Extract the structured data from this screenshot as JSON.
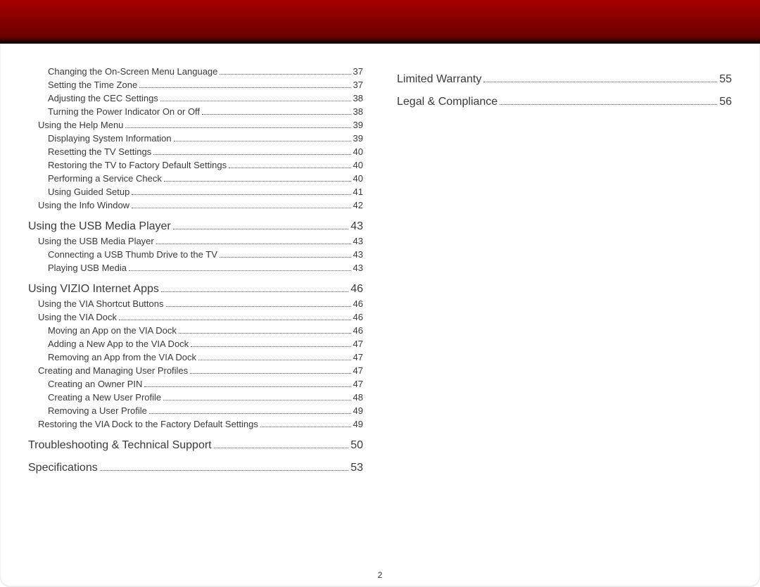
{
  "page_number": "2",
  "columns": [
    [
      {
        "level": 2,
        "label": "Changing the On-Screen Menu Language",
        "page": "37"
      },
      {
        "level": 2,
        "label": "Setting the Time Zone",
        "page": "37"
      },
      {
        "level": 2,
        "label": "Adjusting the CEC Settings",
        "page": "38"
      },
      {
        "level": 2,
        "label": "Turning the Power Indicator On or Off",
        "page": "38"
      },
      {
        "level": 1,
        "label": "Using the Help Menu",
        "page": "39"
      },
      {
        "level": 2,
        "label": "Displaying System Information",
        "page": "39"
      },
      {
        "level": 2,
        "label": "Resetting the TV Settings",
        "page": "40"
      },
      {
        "level": 2,
        "label": "Restoring the TV to Factory Default Settings",
        "page": "40"
      },
      {
        "level": 2,
        "label": "Performing a Service Check",
        "page": "40"
      },
      {
        "level": 2,
        "label": "Using Guided Setup",
        "page": "41"
      },
      {
        "level": 1,
        "label": "Using the Info Window",
        "page": "42"
      },
      {
        "level": 0,
        "label": "Using the USB Media Player",
        "page": "43"
      },
      {
        "level": 1,
        "label": "Using the USB Media Player",
        "page": "43"
      },
      {
        "level": 2,
        "label": "Connecting a USB Thumb Drive to the TV",
        "page": "43"
      },
      {
        "level": 2,
        "label": "Playing USB Media",
        "page": "43"
      },
      {
        "level": 0,
        "label": "Using VIZIO Internet Apps",
        "page": "46"
      },
      {
        "level": 1,
        "label": "Using the VIA Shortcut Buttons",
        "page": "46"
      },
      {
        "level": 1,
        "label": "Using the VIA Dock",
        "page": "46"
      },
      {
        "level": 2,
        "label": "Moving an App on the VIA Dock",
        "page": "46"
      },
      {
        "level": 2,
        "label": "Adding a New App to the VIA Dock",
        "page": "47"
      },
      {
        "level": 2,
        "label": "Removing an App from the VIA Dock",
        "page": "47"
      },
      {
        "level": 1,
        "label": "Creating and Managing User Profiles",
        "page": "47"
      },
      {
        "level": 2,
        "label": "Creating an Owner PIN",
        "page": "47"
      },
      {
        "level": 2,
        "label": "Creating a New User Profile",
        "page": "48"
      },
      {
        "level": 2,
        "label": "Removing a User Profile",
        "page": "49"
      },
      {
        "level": 1,
        "label": "Restoring the VIA Dock to the Factory Default Settings",
        "page": "49"
      },
      {
        "level": 0,
        "label": "Troubleshooting & Technical Support",
        "page": "50"
      },
      {
        "level": 0,
        "label": "Specifications",
        "page": "53"
      }
    ],
    [
      {
        "level": 0,
        "label": "Limited Warranty",
        "page": "55"
      },
      {
        "level": 0,
        "label": "Legal & Compliance",
        "page": "56"
      }
    ]
  ]
}
